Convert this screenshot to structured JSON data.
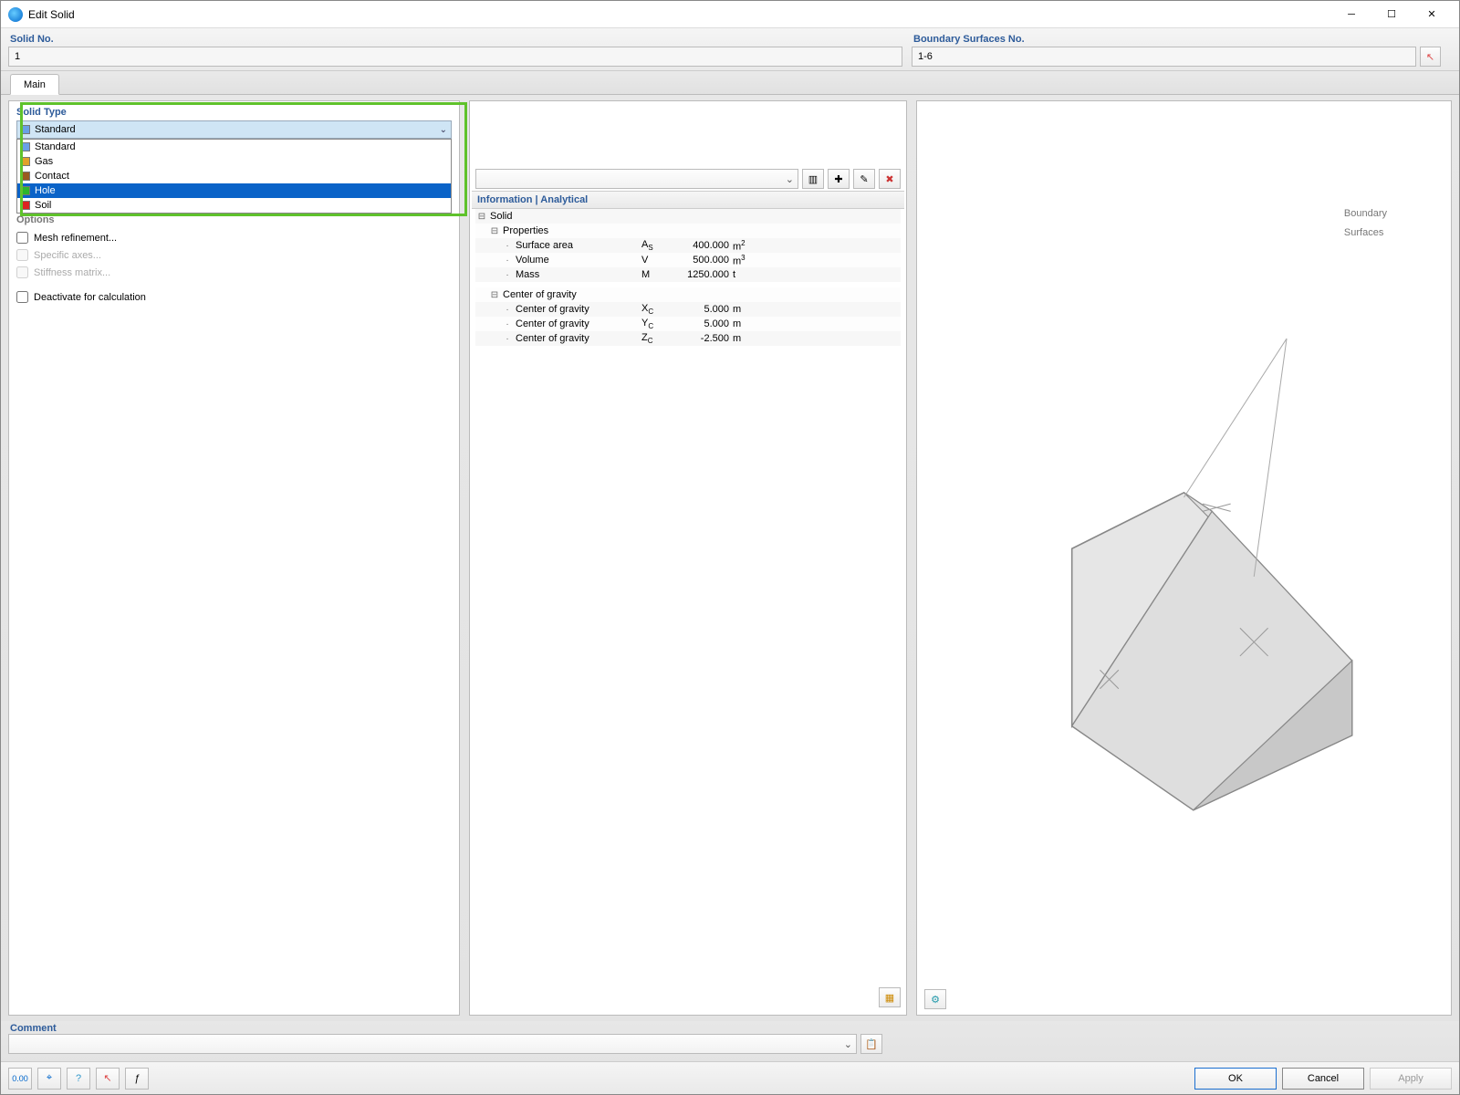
{
  "window": {
    "title": "Edit Solid"
  },
  "top": {
    "solid_no_label": "Solid No.",
    "solid_no_value": "1",
    "boundary_label": "Boundary Surfaces No.",
    "boundary_value": "1-6"
  },
  "tabs": {
    "main": "Main"
  },
  "left": {
    "solid_type_label": "Solid Type",
    "selected_type": "Standard",
    "type_options": [
      {
        "label": "Standard",
        "color": "#6aa0e6"
      },
      {
        "label": "Gas",
        "color": "#e2a12a"
      },
      {
        "label": "Contact",
        "color": "#9a5b20"
      },
      {
        "label": "Hole",
        "color": "#2db52d"
      },
      {
        "label": "Soil",
        "color": "#d22"
      }
    ],
    "options_label": "Options",
    "mesh_refinement": "Mesh refinement...",
    "specific_axes": "Specific axes...",
    "stiffness_matrix": "Stiffness matrix...",
    "deactivate": "Deactivate for calculation"
  },
  "mid": {
    "info_header": "Information | Analytical",
    "tree": {
      "solid": "Solid",
      "properties": "Properties",
      "rows_props": [
        {
          "label": "Surface area",
          "sym": "A",
          "sub": "S",
          "val": "400.000",
          "unit": "m",
          "sup": "2"
        },
        {
          "label": "Volume",
          "sym": "V",
          "sub": "",
          "val": "500.000",
          "unit": "m",
          "sup": "3"
        },
        {
          "label": "Mass",
          "sym": "M",
          "sub": "",
          "val": "1250.000",
          "unit": "t",
          "sup": ""
        }
      ],
      "cog": "Center of gravity",
      "rows_cog": [
        {
          "label": "Center of gravity",
          "sym": "X",
          "sub": "C",
          "val": "5.000",
          "unit": "m"
        },
        {
          "label": "Center of gravity",
          "sym": "Y",
          "sub": "C",
          "val": "5.000",
          "unit": "m"
        },
        {
          "label": "Center of gravity",
          "sym": "Z",
          "sub": "C",
          "val": "-2.500",
          "unit": "m"
        }
      ]
    }
  },
  "right": {
    "label_line1": "Boundary",
    "label_line2": "Surfaces"
  },
  "comment": {
    "label": "Comment",
    "value": ""
  },
  "footer": {
    "ok": "OK",
    "cancel": "Cancel",
    "apply": "Apply"
  },
  "colors": {
    "swatches": {
      "standard": "#6aa0e6"
    }
  }
}
